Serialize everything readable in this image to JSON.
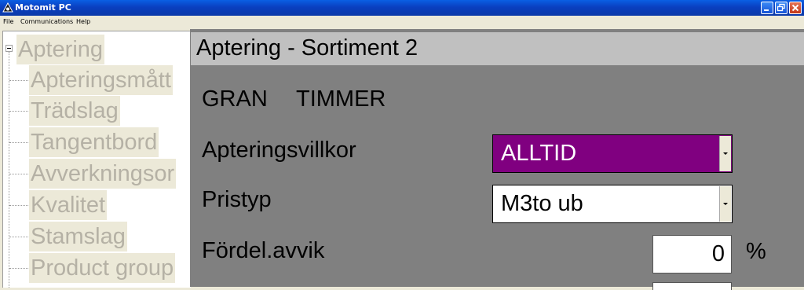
{
  "window": {
    "title": "Motomit PC"
  },
  "menu": [
    "File",
    "Communications",
    "Help"
  ],
  "tree": {
    "root": "Aptering",
    "children": [
      "Apteringsmått",
      "Trädslag",
      "Tangentbord",
      "Avverkningsor",
      "Kvalitet",
      "Stamslag",
      "Product group"
    ]
  },
  "panel": {
    "title": "Aptering - Sortiment 2",
    "species": "GRAN",
    "assortment": "TIMMER",
    "fields": {
      "apteringsvillkor": {
        "label": "Apteringsvillkor",
        "value": "ALLTID",
        "bg": "#800080",
        "fg": "#ffffff"
      },
      "pristyp": {
        "label": "Pristyp",
        "value": "M3to ub"
      },
      "fordel": {
        "label": "Fördel.avvik",
        "value": "0",
        "unit": "%"
      }
    }
  }
}
